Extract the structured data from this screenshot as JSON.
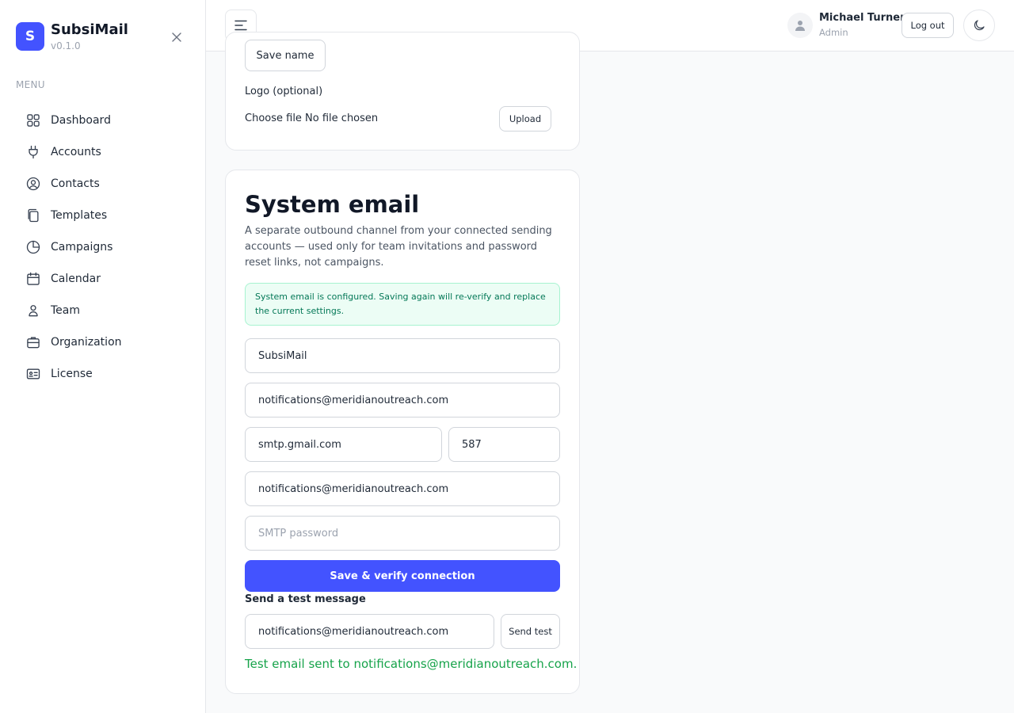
{
  "brand": {
    "logo_letter": "S",
    "name": "SubsiMail",
    "version": "v0.1.0"
  },
  "sidebar": {
    "menu_label": "MENU",
    "items": [
      {
        "label": "Dashboard",
        "icon": "grid-icon"
      },
      {
        "label": "Accounts",
        "icon": "plug-icon"
      },
      {
        "label": "Contacts",
        "icon": "user-circle-icon"
      },
      {
        "label": "Templates",
        "icon": "copy-icon"
      },
      {
        "label": "Campaigns",
        "icon": "pie-chart-icon"
      },
      {
        "label": "Calendar",
        "icon": "calendar-icon"
      },
      {
        "label": "Team",
        "icon": "user-icon"
      },
      {
        "label": "Organization",
        "icon": "briefcase-icon"
      },
      {
        "label": "License",
        "icon": "id-card-icon"
      }
    ]
  },
  "header": {
    "user_name": "Michael Turner",
    "user_role": "Admin",
    "logout_label": "Log out"
  },
  "branding_card": {
    "save_name_label": "Save name",
    "logo_label": "Logo (optional)",
    "file_input_text": "Choose file No file chosen",
    "upload_label": "Upload"
  },
  "system_email": {
    "title": "System email",
    "description": "A separate outbound channel from your connected sending accounts — used only for team invitations and password reset links, not campaigns.",
    "alert": "System email is configured. Saving again will re-verify and replace the current settings.",
    "sender_name": "SubsiMail",
    "from_email": "notifications@meridianoutreach.com",
    "smtp_host": "smtp.gmail.com",
    "smtp_port": "587",
    "smtp_username": "notifications@meridianoutreach.com",
    "smtp_password_placeholder": "SMTP password",
    "save_verify_label": "Save & verify connection",
    "test_label": "Send a test message",
    "test_recipient": "notifications@meridianoutreach.com",
    "send_test_label": "Send test",
    "success_message": "Test email sent to notifications@meridianoutreach.com."
  },
  "colors": {
    "accent": "#4353ff",
    "success": "#16a34a",
    "alert_bg": "#ecfdf5"
  }
}
